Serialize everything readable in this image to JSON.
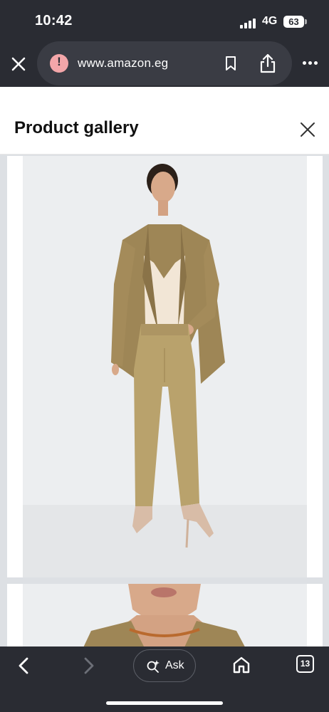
{
  "status_bar": {
    "time": "10:42",
    "network": "4G",
    "battery": "63"
  },
  "browser": {
    "url": "www.amazon.eg",
    "icons": {
      "close": "close-icon",
      "site_warning": "warning-icon",
      "bookmark": "bookmark-icon",
      "share": "share-icon",
      "more": "more-icon"
    }
  },
  "gallery": {
    "title": "Product gallery",
    "close_icon": "close-icon",
    "images": [
      {
        "alt": "Model in khaki blazer and wide trousers, full length"
      },
      {
        "alt": "Model in khaki blazer, close-up"
      }
    ]
  },
  "bottom_bar": {
    "ask_label": "Ask",
    "tab_count": "13",
    "icons": {
      "back": "chevron-left-icon",
      "forward": "chevron-right-icon",
      "ask": "sparkle-search-icon",
      "home": "home-icon"
    }
  },
  "colors": {
    "browser_chrome": "#2a2c33",
    "url_pill": "#3a3c44",
    "warning": "#f3a6a9",
    "garment": "#a8925e"
  }
}
